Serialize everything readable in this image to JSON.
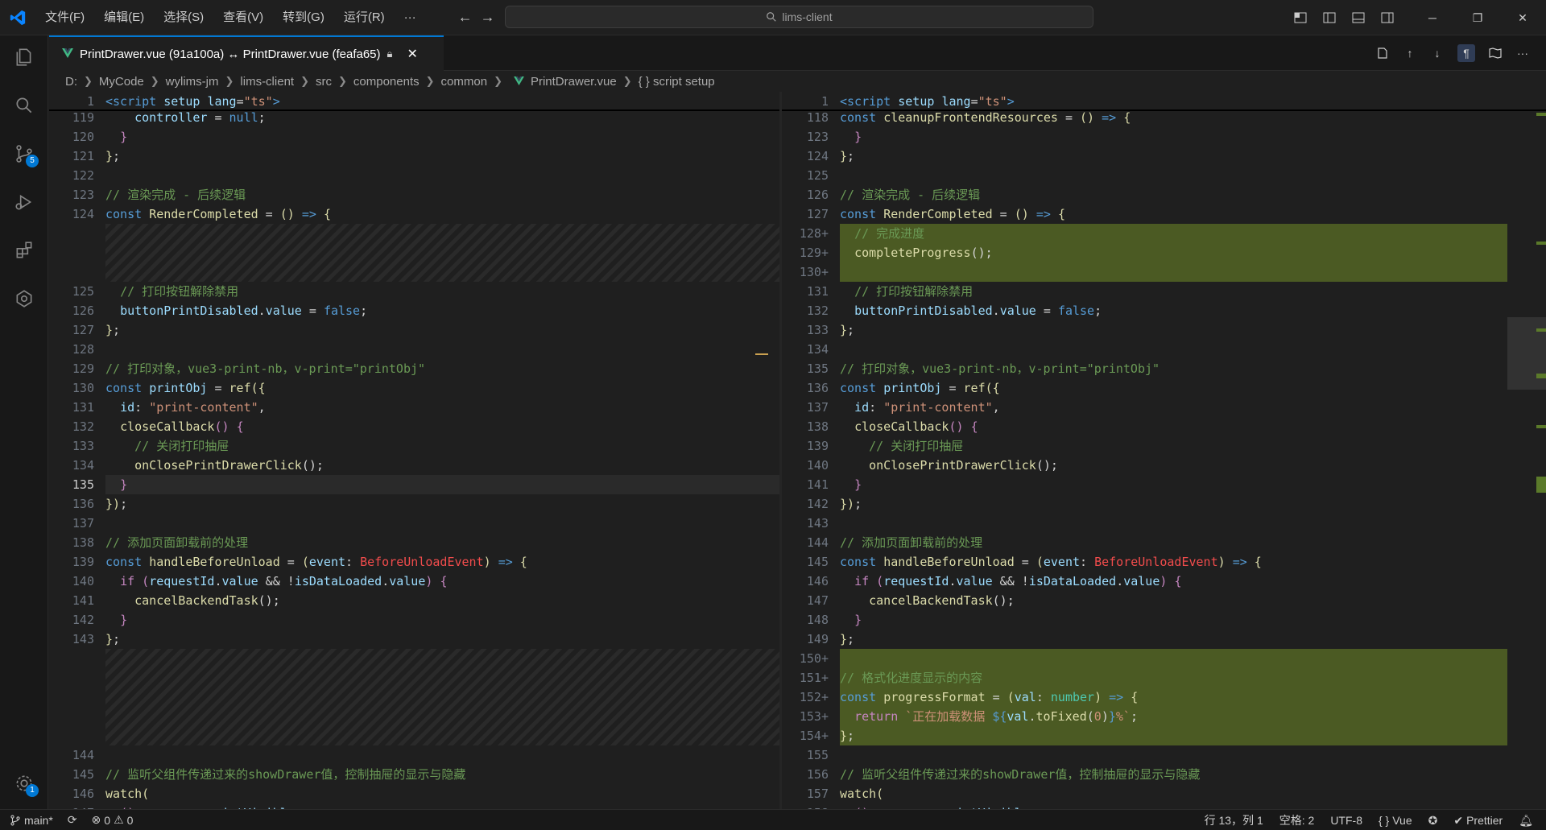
{
  "menu": [
    "文件(F)",
    "编辑(E)",
    "选择(S)",
    "查看(V)",
    "转到(G)",
    "运行(R)",
    "···"
  ],
  "search": {
    "text": "lims-client"
  },
  "tab": {
    "title": "PrintDrawer.vue (91a100a) ↔ PrintDrawer.vue (feafa65)"
  },
  "breadcrumb": [
    "D:",
    "MyCode",
    "wylims-jm",
    "lims-client",
    "src",
    "components",
    "common",
    "PrintDrawer.vue",
    "{ } script setup"
  ],
  "activity": {
    "scm_badge": "5",
    "settings_badge": "1"
  },
  "left_editor": {
    "sticky": [
      {
        "ln": "1",
        "html": "<span class='kw'>&lt;script</span> <span class='vr'>setup</span> <span class='vr'>lang</span>=<span class='str'>\"ts\"</span><span class='kw'>&gt;</span>"
      }
    ],
    "lines": [
      {
        "ln": "119",
        "html": "    <span class='vr'>controller</span> = <span class='kw'>null</span>;"
      },
      {
        "ln": "120",
        "html": "  <span class='ctl'>}</span>"
      },
      {
        "ln": "121",
        "html": "<span class='fn'>}</span>;"
      },
      {
        "ln": "122",
        "html": ""
      },
      {
        "ln": "123",
        "html": "<span class='cm'>// 渲染完成 - 后续逻辑</span>"
      },
      {
        "ln": "124",
        "html": "<span class='kw'>const</span> <span class='fn'>RenderCompleted</span> = <span class='fn'>()</span> <span class='kw'>=&gt;</span> <span class='fn'>{</span>"
      },
      {
        "ln": "",
        "html": ""
      },
      {
        "ln": "",
        "html": ""
      },
      {
        "ln": "",
        "html": ""
      },
      {
        "ln": "125",
        "html": "  <span class='cm'>// 打印按钮解除禁用</span>"
      },
      {
        "ln": "126",
        "html": "  <span class='vr'>buttonPrintDisabled</span>.<span class='vr'>value</span> = <span class='kw'>false</span>;"
      },
      {
        "ln": "127",
        "html": "<span class='fn'>}</span>;"
      },
      {
        "ln": "128",
        "html": ""
      },
      {
        "ln": "129",
        "html": "<span class='cm'>// 打印对象，vue3-print-nb，v-print=\"printObj\"</span>"
      },
      {
        "ln": "130",
        "html": "<span class='kw'>const</span> <span class='vr'>printObj</span> = <span class='fn'>ref</span><span class='fn'>({</span>"
      },
      {
        "ln": "131",
        "html": "  <span class='vr'>id</span>: <span class='str'>\"print-content\"</span>,"
      },
      {
        "ln": "132",
        "html": "  <span class='fn'>closeCallback</span><span class='ctl'>()</span> <span class='ctl'>{</span>"
      },
      {
        "ln": "133",
        "html": "    <span class='cm'>// 关闭打印抽屉</span>"
      },
      {
        "ln": "134",
        "html": "    <span class='fn'>onClosePrintDrawerClick</span>();"
      },
      {
        "ln": "135",
        "html": "  <span class='ctl'>}</span>"
      },
      {
        "ln": "136",
        "html": "<span class='fn'>})</span>;"
      },
      {
        "ln": "137",
        "html": ""
      },
      {
        "ln": "138",
        "html": "<span class='cm'>// 添加页面卸载前的处理</span>"
      },
      {
        "ln": "139",
        "html": "<span class='kw'>const</span> <span class='fn'>handleBeforeUnload</span> = <span class='fn'>(</span><span class='vr'>event</span>: <span class='ty' style='color:#f14c4c'>BeforeUnloadEvent</span><span class='fn'>)</span> <span class='kw'>=&gt;</span> <span class='fn'>{</span>"
      },
      {
        "ln": "140",
        "html": "  <span class='ctl'>if</span> <span class='ctl'>(</span><span class='vr'>requestId</span>.<span class='vr'>value</span> &amp;&amp; !<span class='vr'>isDataLoaded</span>.<span class='vr'>value</span><span class='ctl'>)</span> <span class='ctl'>{</span>"
      },
      {
        "ln": "141",
        "html": "    <span class='fn'>cancelBackendTask</span>();"
      },
      {
        "ln": "142",
        "html": "  <span class='ctl'>}</span>"
      },
      {
        "ln": "143",
        "html": "<span class='fn'>}</span>;"
      },
      {
        "ln": "",
        "html": ""
      },
      {
        "ln": "",
        "html": ""
      },
      {
        "ln": "",
        "html": ""
      },
      {
        "ln": "",
        "html": ""
      },
      {
        "ln": "",
        "html": ""
      },
      {
        "ln": "144",
        "html": ""
      },
      {
        "ln": "145",
        "html": "<span class='cm'>// 监听父组件传递过来的showDrawer值，控制抽屉的显示与隐藏</span>"
      },
      {
        "ln": "146",
        "html": "<span class='fn'>watch</span><span class='fn'>(</span>"
      },
      {
        "ln": "147",
        "html": "  <span class='ctl'>()</span> <span class='kw'>=&gt;</span> <span class='vr'>props</span>.<span class='vr'>printVisible</span>,"
      }
    ]
  },
  "right_editor": {
    "sticky": [
      {
        "ln": "1",
        "html": "<span class='kw'>&lt;script</span> <span class='vr'>setup</span> <span class='vr'>lang</span>=<span class='str'>\"ts\"</span><span class='kw'>&gt;</span>"
      }
    ],
    "lines": [
      {
        "ln": "118",
        "html": "<span class='kw'>const</span> <span class='fn'>cleanupFrontendResources</span> = <span class='fn'>()</span> <span class='kw'>=&gt;</span> <span class='fn'>{</span>"
      },
      {
        "ln": "123",
        "html": "  <span class='ctl'>}</span>"
      },
      {
        "ln": "124",
        "html": "<span class='fn'>}</span>;"
      },
      {
        "ln": "125",
        "html": ""
      },
      {
        "ln": "126",
        "html": "<span class='cm'>// 渲染完成 - 后续逻辑</span>"
      },
      {
        "ln": "127",
        "html": "<span class='kw'>const</span> <span class='fn'>RenderCompleted</span> = <span class='fn'>()</span> <span class='kw'>=&gt;</span> <span class='fn'>{</span>"
      },
      {
        "ln": "128+",
        "html": "  <span class='cm'>// 完成进度</span>"
      },
      {
        "ln": "129+",
        "html": "  <span class='fn'>completeProgress</span>();"
      },
      {
        "ln": "130+",
        "html": ""
      },
      {
        "ln": "131",
        "html": "  <span class='cm'>// 打印按钮解除禁用</span>"
      },
      {
        "ln": "132",
        "html": "  <span class='vr'>buttonPrintDisabled</span>.<span class='vr'>value</span> = <span class='kw'>false</span>;"
      },
      {
        "ln": "133",
        "html": "<span class='fn'>}</span>;"
      },
      {
        "ln": "134",
        "html": ""
      },
      {
        "ln": "135",
        "html": "<span class='cm'>// 打印对象，vue3-print-nb，v-print=\"printObj\"</span>"
      },
      {
        "ln": "136",
        "html": "<span class='kw'>const</span> <span class='vr'>printObj</span> = <span class='fn'>ref</span><span class='fn'>({</span>"
      },
      {
        "ln": "137",
        "html": "  <span class='vr'>id</span>: <span class='str'>\"print-content\"</span>,"
      },
      {
        "ln": "138",
        "html": "  <span class='fn'>closeCallback</span><span class='ctl'>()</span> <span class='ctl'>{</span>"
      },
      {
        "ln": "139",
        "html": "    <span class='cm'>// 关闭打印抽屉</span>"
      },
      {
        "ln": "140",
        "html": "    <span class='fn'>onClosePrintDrawerClick</span>();"
      },
      {
        "ln": "141",
        "html": "  <span class='ctl'>}</span>"
      },
      {
        "ln": "142",
        "html": "<span class='fn'>})</span>;"
      },
      {
        "ln": "143",
        "html": ""
      },
      {
        "ln": "144",
        "html": "<span class='cm'>// 添加页面卸载前的处理</span>"
      },
      {
        "ln": "145",
        "html": "<span class='kw'>const</span> <span class='fn'>handleBeforeUnload</span> = <span class='fn'>(</span><span class='vr'>event</span>: <span class='ty' style='color:#f14c4c'>BeforeUnloadEvent</span><span class='fn'>)</span> <span class='kw'>=&gt;</span> <span class='fn'>{</span>"
      },
      {
        "ln": "146",
        "html": "  <span class='ctl'>if</span> <span class='ctl'>(</span><span class='vr'>requestId</span>.<span class='vr'>value</span> &amp;&amp; !<span class='vr'>isDataLoaded</span>.<span class='vr'>value</span><span class='ctl'>)</span> <span class='ctl'>{</span>"
      },
      {
        "ln": "147",
        "html": "    <span class='fn'>cancelBackendTask</span>();"
      },
      {
        "ln": "148",
        "html": "  <span class='ctl'>}</span>"
      },
      {
        "ln": "149",
        "html": "<span class='fn'>}</span>;"
      },
      {
        "ln": "150+",
        "html": ""
      },
      {
        "ln": "151+",
        "html": "<span class='cm'>// 格式化进度显示的内容</span>"
      },
      {
        "ln": "152+",
        "html": "<span class='kw'>const</span> <span class='fn'>progressFormat</span> = <span class='fn'>(</span><span class='vr'>val</span>: <span class='ty'>number</span><span class='fn'>)</span> <span class='kw'>=&gt;</span> <span class='fn'>{</span>"
      },
      {
        "ln": "153+",
        "html": "  <span class='ctl'>return</span> <span class='str'>`正在加载数据 </span><span class='kw'>${</span><span class='vr'>val</span>.<span class='fn'>toFixed</span>(<span class='str'>0</span>)<span class='kw'>}</span><span class='str'>%`</span>;"
      },
      {
        "ln": "154+",
        "html": "<span class='fn'>}</span>;"
      },
      {
        "ln": "155",
        "html": ""
      },
      {
        "ln": "156",
        "html": "<span class='cm'>// 监听父组件传递过来的showDrawer值，控制抽屉的显示与隐藏</span>"
      },
      {
        "ln": "157",
        "html": "<span class='fn'>watch</span><span class='fn'>(</span>"
      },
      {
        "ln": "158",
        "html": "  <span class='ctl'>()</span> <span class='kw'>=&gt;</span> <span class='vr'>props</span>.<span class='vr'>printVisible</span>,"
      }
    ]
  },
  "status": {
    "branch": "main*",
    "errors": "0",
    "warnings": "0",
    "position": "行 13，列 1",
    "indent": "空格: 2",
    "encoding": "UTF-8",
    "language": "Vue",
    "formatter": "Prettier"
  },
  "colors": {
    "accent": "#0078d4",
    "added_bg": "#4b5a23"
  }
}
